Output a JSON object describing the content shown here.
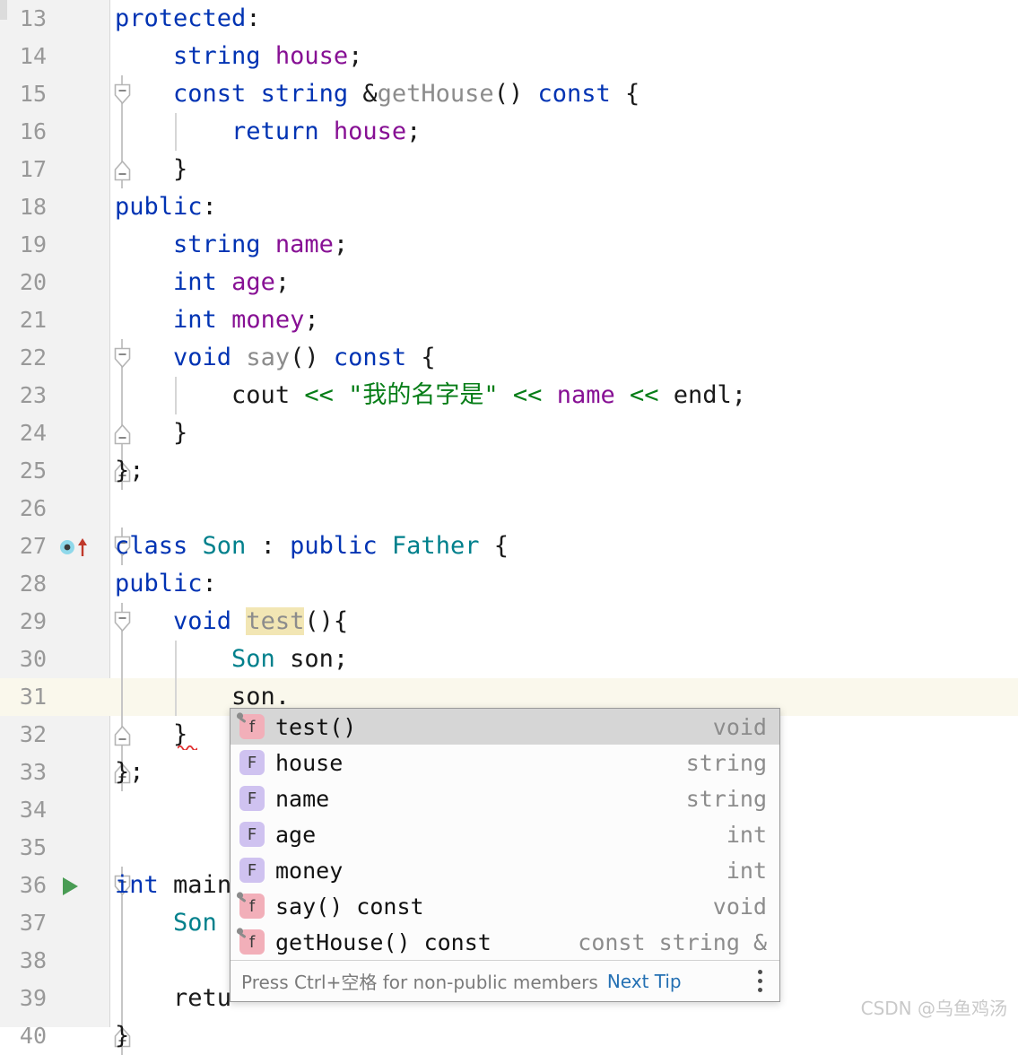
{
  "editor": {
    "language": "C++",
    "colors": {
      "keyword": "#0033B3",
      "class_name": "#00808C",
      "function": "#8C8C8C",
      "field": "#871094",
      "string": "#067D17",
      "plain": "#1A1A1A",
      "gutter_bg": "#F2F2F2",
      "line_number": "#999999",
      "current_line_bg": "#FAF8EC",
      "identifier_highlight_bg": "#F2E6B4",
      "popup_selected_bg": "#D6D6D6",
      "method_icon_bg": "#F2AFB9",
      "field_icon_bg": "#CFC2F0",
      "link": "#2470B3",
      "run_marker": "#499C54"
    },
    "lines": [
      {
        "num": "13",
        "indent": 0,
        "gutter": "",
        "fold": "none",
        "text": "protected:"
      },
      {
        "num": "14",
        "indent": 1,
        "gutter": "",
        "fold": "none",
        "text": "    string house;"
      },
      {
        "num": "15",
        "indent": 1,
        "gutter": "",
        "fold": "open",
        "text": "    const string &getHouse() const {"
      },
      {
        "num": "16",
        "indent": 2,
        "gutter": "",
        "fold": "bar",
        "text": "        return house;"
      },
      {
        "num": "17",
        "indent": 1,
        "gutter": "",
        "fold": "close",
        "text": "    }"
      },
      {
        "num": "18",
        "indent": 0,
        "gutter": "",
        "fold": "none",
        "text": "public:"
      },
      {
        "num": "19",
        "indent": 1,
        "gutter": "",
        "fold": "none",
        "text": "    string name;"
      },
      {
        "num": "20",
        "indent": 1,
        "gutter": "",
        "fold": "none",
        "text": "    int age;"
      },
      {
        "num": "21",
        "indent": 1,
        "gutter": "",
        "fold": "none",
        "text": "    int money;"
      },
      {
        "num": "22",
        "indent": 1,
        "gutter": "",
        "fold": "open",
        "text": "    void say() const {"
      },
      {
        "num": "23",
        "indent": 2,
        "gutter": "",
        "fold": "bar",
        "text": "        cout << \"我的名字是\" << name << endl;"
      },
      {
        "num": "24",
        "indent": 1,
        "gutter": "",
        "fold": "close",
        "text": "    }"
      },
      {
        "num": "25",
        "indent": 0,
        "gutter": "",
        "fold": "close",
        "text": "};"
      },
      {
        "num": "26",
        "indent": 0,
        "gutter": "",
        "fold": "none",
        "text": ""
      },
      {
        "num": "27",
        "indent": 0,
        "gutter": "inherit",
        "fold": "open",
        "text": "class Son : public Father {"
      },
      {
        "num": "28",
        "indent": 0,
        "gutter": "",
        "fold": "none",
        "text": "public:"
      },
      {
        "num": "29",
        "indent": 1,
        "gutter": "",
        "fold": "open",
        "text": "    void test(){"
      },
      {
        "num": "30",
        "indent": 2,
        "gutter": "",
        "fold": "bar",
        "text": "        Son son;"
      },
      {
        "num": "31",
        "indent": 2,
        "gutter": "",
        "fold": "bar",
        "text": "        son.",
        "current": true
      },
      {
        "num": "32",
        "indent": 1,
        "gutter": "",
        "fold": "close",
        "text": "    }"
      },
      {
        "num": "33",
        "indent": 0,
        "gutter": "",
        "fold": "close",
        "text": "};"
      },
      {
        "num": "34",
        "indent": 0,
        "gutter": "",
        "fold": "none",
        "text": ""
      },
      {
        "num": "35",
        "indent": 0,
        "gutter": "",
        "fold": "none",
        "text": ""
      },
      {
        "num": "36",
        "indent": 0,
        "gutter": "run",
        "fold": "open",
        "text": "int main"
      },
      {
        "num": "37",
        "indent": 1,
        "gutter": "",
        "fold": "bar",
        "text": "    Son"
      },
      {
        "num": "38",
        "indent": 0,
        "gutter": "",
        "fold": "bar",
        "text": ""
      },
      {
        "num": "39",
        "indent": 1,
        "gutter": "",
        "fold": "bar",
        "text": "    retu"
      },
      {
        "num": "40",
        "indent": 0,
        "gutter": "",
        "fold": "close",
        "text": "}"
      }
    ]
  },
  "completion_popup": {
    "items": [
      {
        "icon": "method-icon",
        "icon_letter": "f",
        "kind": "method",
        "name": "test()",
        "type": "void",
        "selected": true
      },
      {
        "icon": "field-icon",
        "icon_letter": "F",
        "kind": "field",
        "name": "house",
        "type": "string",
        "selected": false
      },
      {
        "icon": "field-icon",
        "icon_letter": "F",
        "kind": "field",
        "name": "name",
        "type": "string",
        "selected": false
      },
      {
        "icon": "field-icon",
        "icon_letter": "F",
        "kind": "field",
        "name": "age",
        "type": "int",
        "selected": false
      },
      {
        "icon": "field-icon",
        "icon_letter": "F",
        "kind": "field",
        "name": "money",
        "type": "int",
        "selected": false
      },
      {
        "icon": "method-icon",
        "icon_letter": "f",
        "kind": "method",
        "name": "say() const",
        "type": "void",
        "selected": false
      },
      {
        "icon": "method-icon",
        "icon_letter": "f",
        "kind": "method",
        "name": "getHouse() const",
        "type": "const string &",
        "selected": false
      }
    ],
    "footer": {
      "hint": "Press Ctrl+空格 for non-public members",
      "next_tip_label": "Next Tip",
      "menu_icon": "kebab-menu-icon"
    }
  },
  "watermark": {
    "text": "CSDN @乌鱼鸡汤"
  }
}
